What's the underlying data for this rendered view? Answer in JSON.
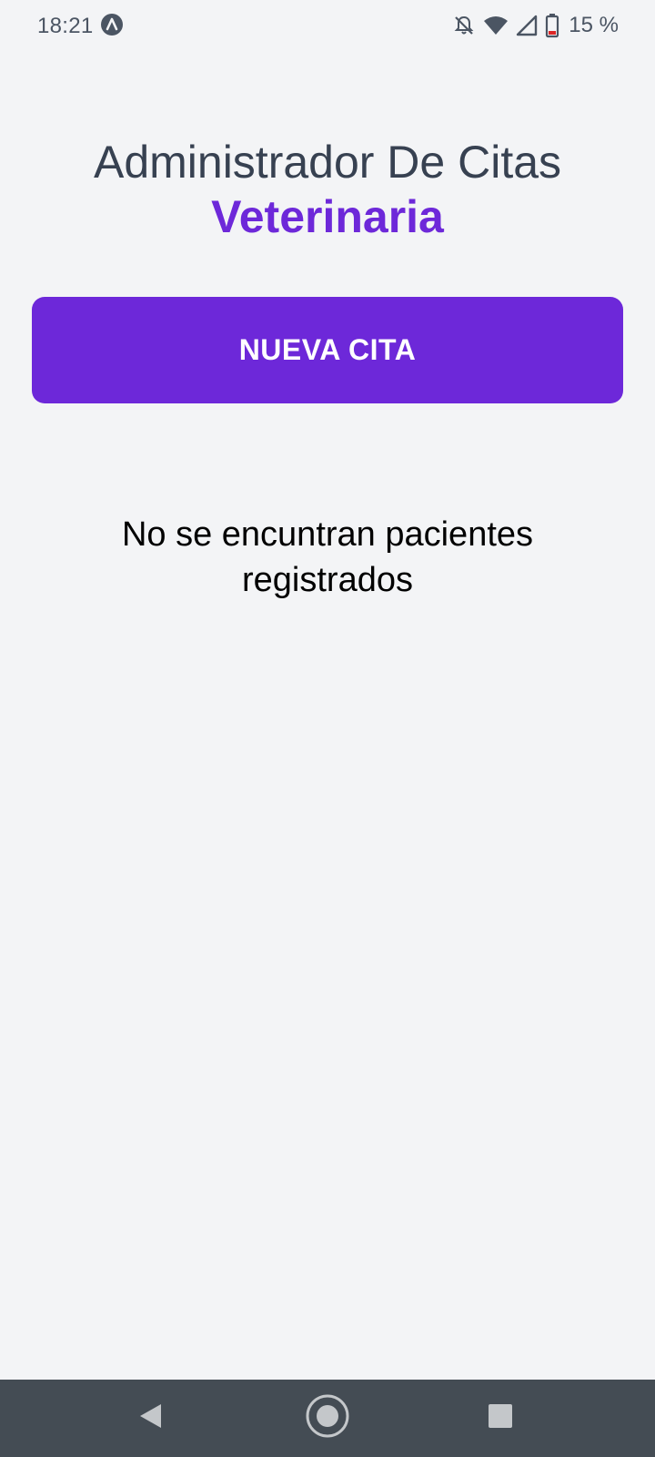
{
  "status_bar": {
    "time": "18:21",
    "app_icon": "app-a-icon",
    "icons": [
      "notifications-off-icon",
      "wifi-icon",
      "cell-signal-icon",
      "battery-low-icon"
    ],
    "battery_percent": "15 %"
  },
  "header": {
    "title": "Administrador De Citas",
    "accent": "Veterinaria"
  },
  "new_appointment_button": {
    "label": "NUEVA CITA"
  },
  "empty_state": {
    "message": "No se encuntran pacientes registrados"
  },
  "nav_bar": {
    "buttons": [
      "back-icon",
      "home-icon",
      "recents-icon"
    ]
  },
  "colors": {
    "background": "#f3f4f6",
    "accent": "#6d28d9",
    "title": "#374151",
    "nav_bar": "#444c54"
  }
}
